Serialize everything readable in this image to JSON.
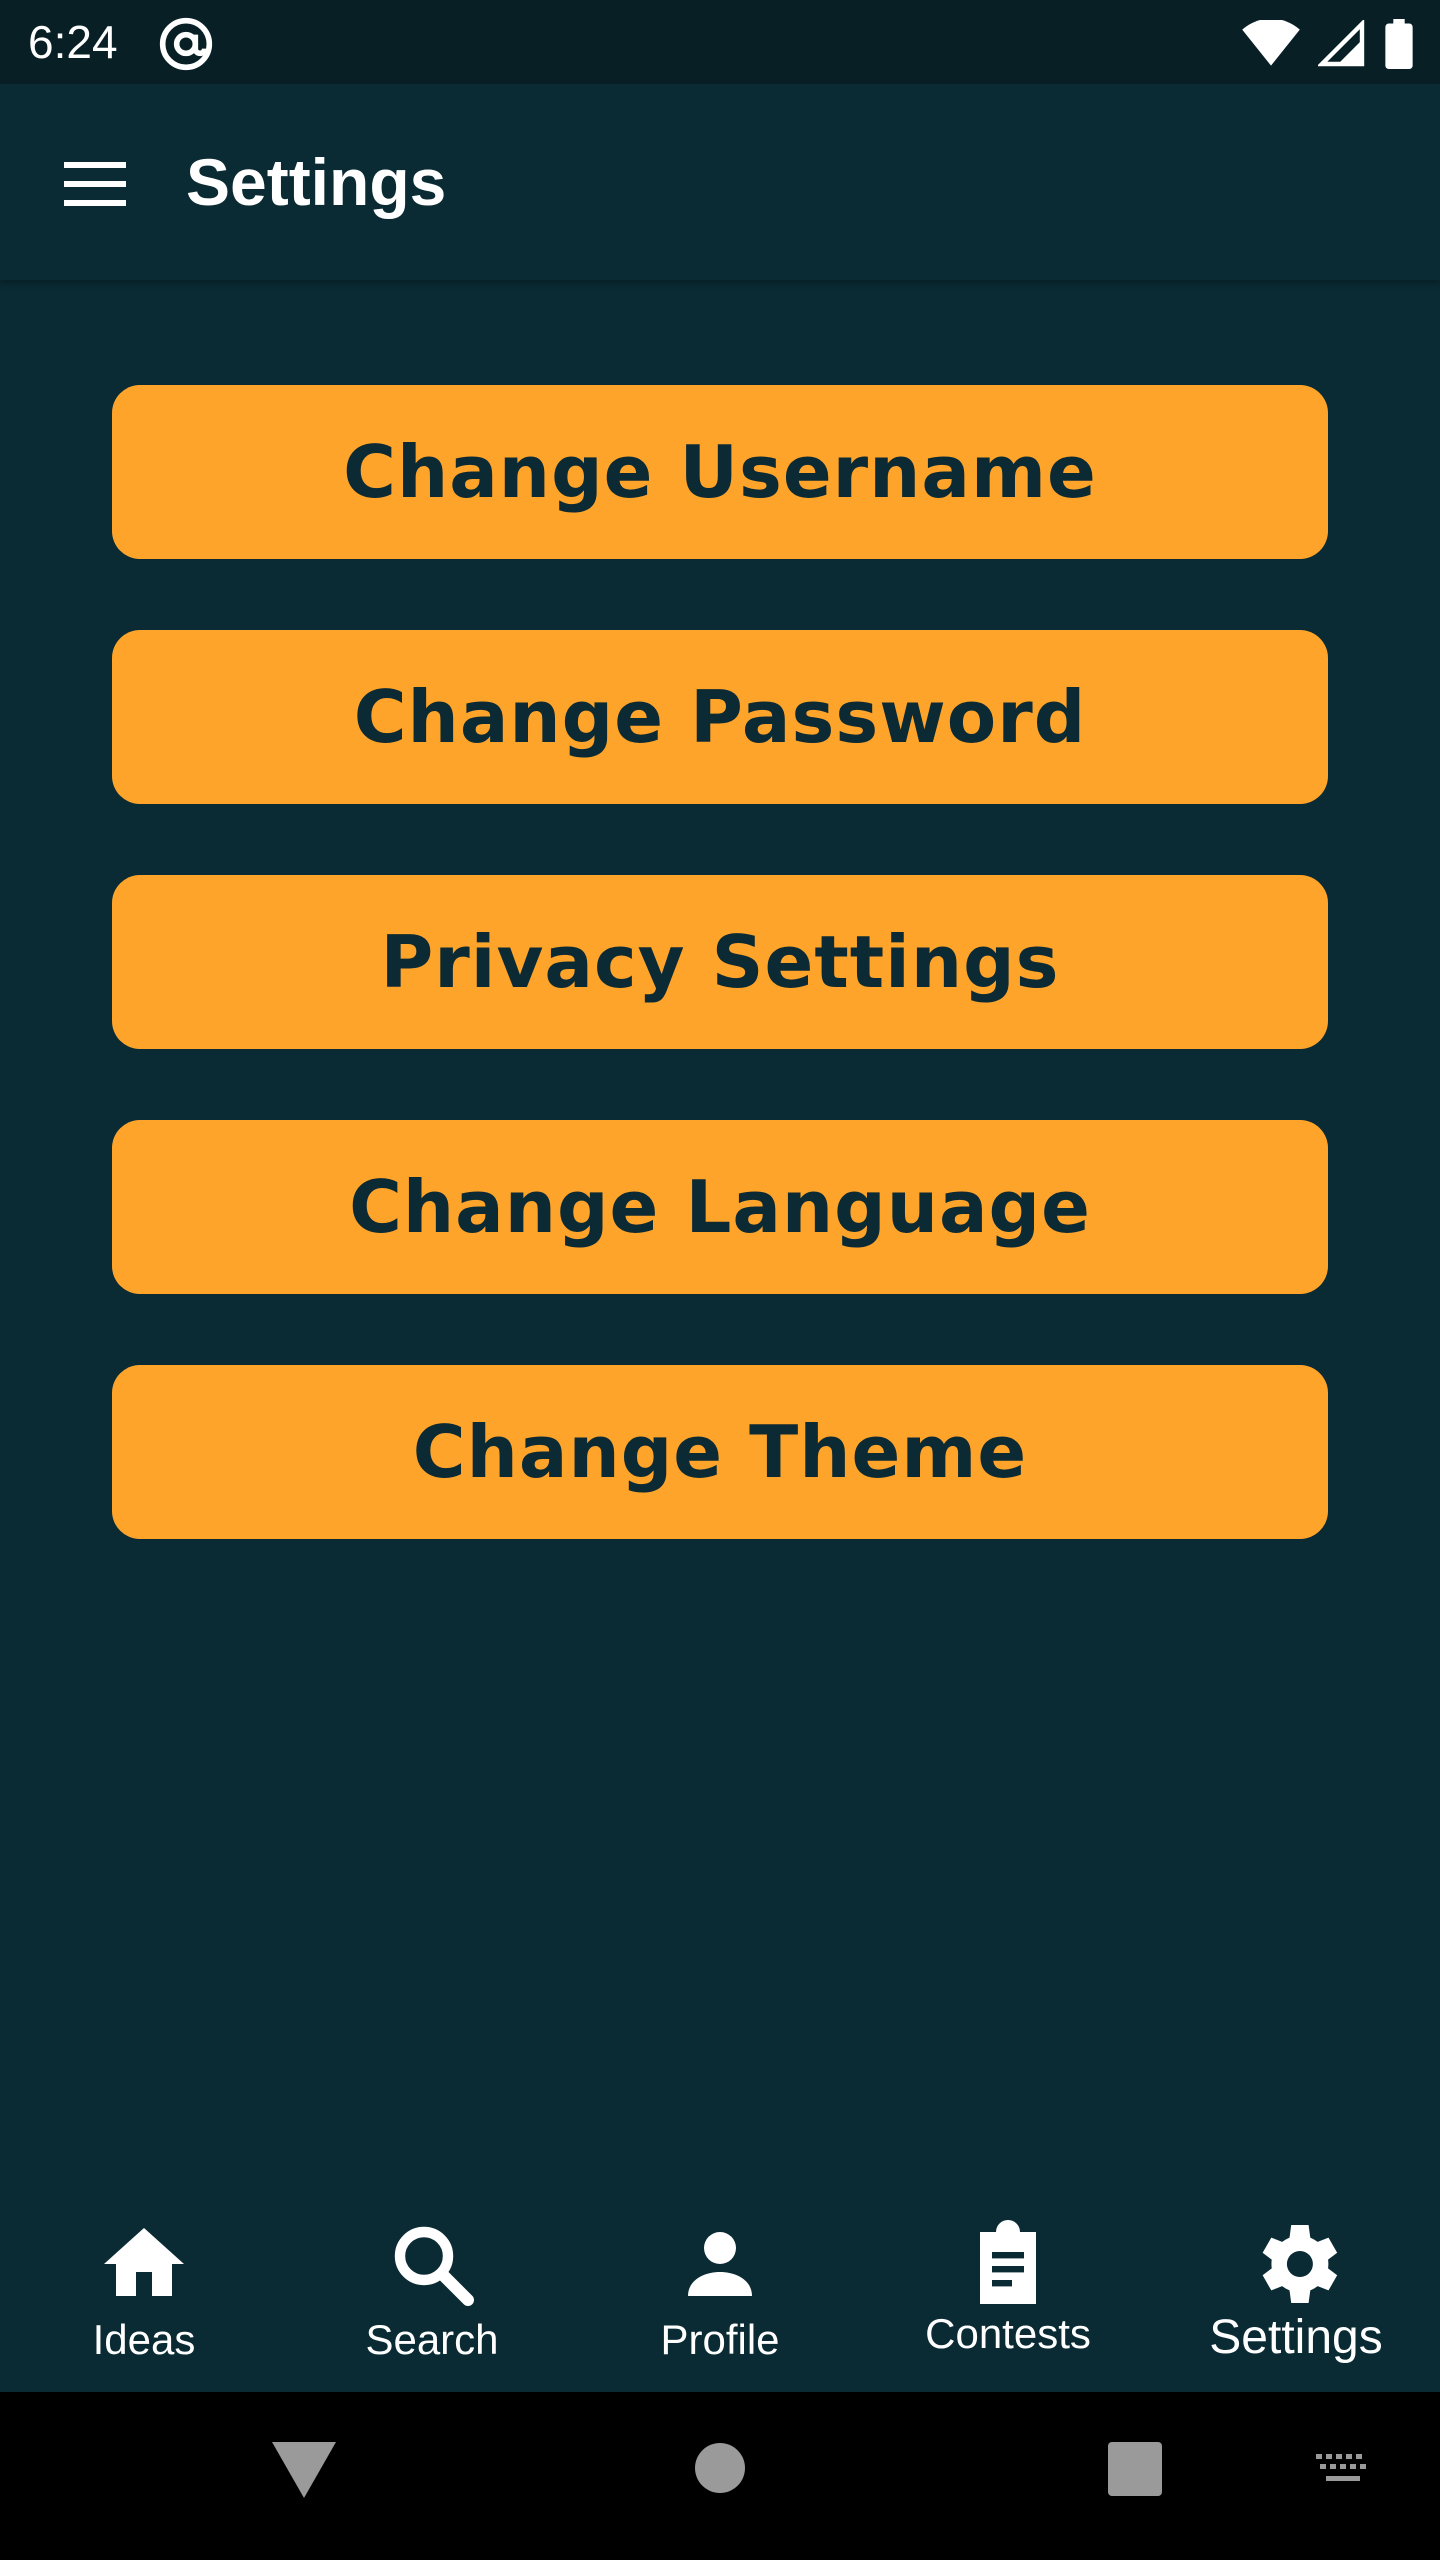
{
  "status_bar": {
    "time": "6:24",
    "icons": [
      "at-sign-icon",
      "wifi-icon",
      "signal-icon",
      "battery-icon"
    ]
  },
  "app_bar": {
    "title": "Settings",
    "menu_icon": "hamburger-menu-icon"
  },
  "settings_buttons": [
    {
      "label": "Change Username"
    },
    {
      "label": "Change Password"
    },
    {
      "label": "Privacy Settings"
    },
    {
      "label": "Change Language"
    },
    {
      "label": "Change Theme"
    }
  ],
  "bottom_nav": {
    "items": [
      {
        "label": "Ideas",
        "icon": "home-icon"
      },
      {
        "label": "Search",
        "icon": "search-icon"
      },
      {
        "label": "Profile",
        "icon": "person-icon"
      },
      {
        "label": "Contests",
        "icon": "clipboard-icon"
      },
      {
        "label": "Settings",
        "icon": "gear-icon",
        "active": true
      }
    ]
  },
  "system_nav": {
    "icons": [
      "back-icon",
      "home-circle-icon",
      "recents-icon",
      "keyboard-icon"
    ]
  },
  "colors": {
    "background": "#0a2b33",
    "status_bar": "#071f25",
    "button": "#ffa42b",
    "button_text": "#0c2a33",
    "nav_text": "#ffffff",
    "system_nav": "#000000"
  }
}
